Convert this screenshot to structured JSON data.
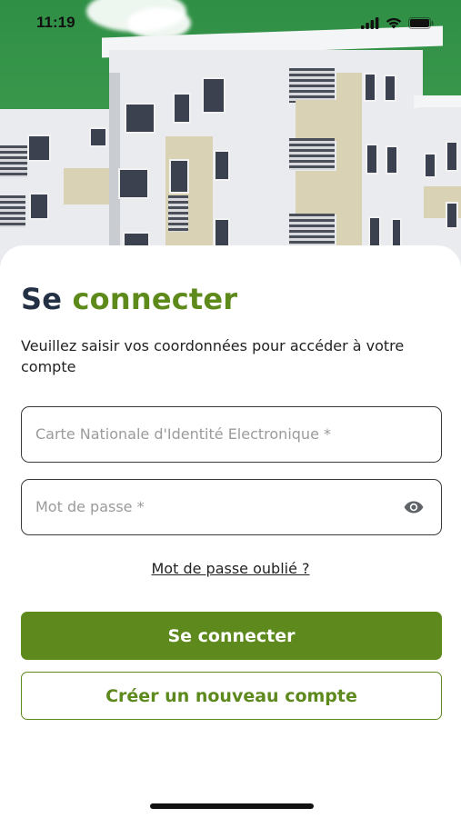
{
  "status_bar": {
    "time": "11:19"
  },
  "hero": {
    "image": "apartment-building-photo"
  },
  "login": {
    "title_part1": "Se",
    "title_part2": "connecter",
    "subtitle": "Veuillez saisir vos coordonnées pour accéder à votre compte",
    "id_field": {
      "placeholder": "Carte Nationale d'Identité Electronique *",
      "value": ""
    },
    "password_field": {
      "placeholder": "Mot de passe *",
      "value": "",
      "toggle_icon": "eye-icon"
    },
    "forgot_password": "Mot de passe oublié ?",
    "login_button": "Se connecter",
    "create_account_button": "Créer un nouveau compte"
  },
  "colors": {
    "brand_green": "#5e891d",
    "title_dark": "#243044",
    "hero_green": "#3c9a4d"
  }
}
